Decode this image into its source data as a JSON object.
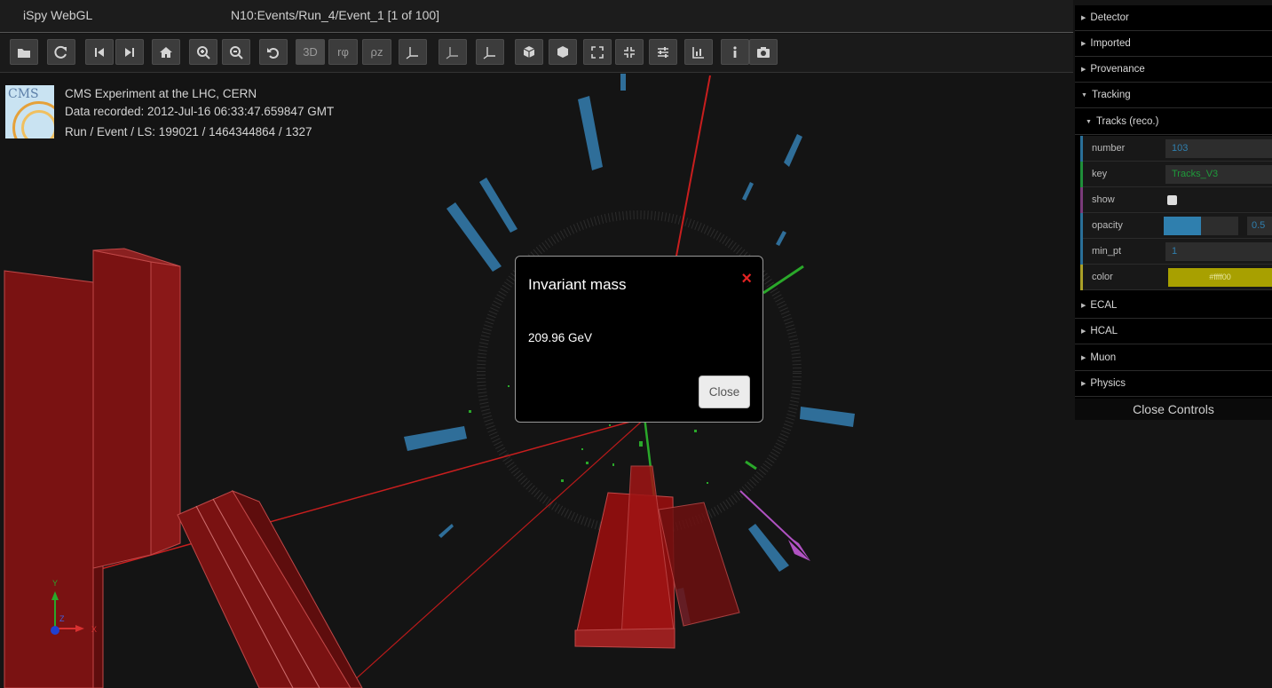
{
  "app": {
    "title": "iSpy WebGL",
    "event_title": "N10:Events/Run_4/Event_1 [1 of 100]"
  },
  "toolbar": {
    "buttons": [
      {
        "name": "open-file-button",
        "icon": "folder-icon"
      },
      {
        "name": "reload-button",
        "icon": "refresh-icon"
      },
      {
        "name": "prev-event-button",
        "icon": "skip-back-icon"
      },
      {
        "name": "next-event-button",
        "icon": "skip-forward-icon"
      },
      {
        "name": "home-view-button",
        "icon": "home-icon"
      },
      {
        "name": "zoom-in-button",
        "icon": "zoom-in-icon"
      },
      {
        "name": "zoom-out-button",
        "icon": "zoom-out-icon"
      },
      {
        "name": "reset-rotation-button",
        "icon": "undo-icon"
      },
      {
        "name": "view-3d-button",
        "label": "3D"
      },
      {
        "name": "view-rphi-button",
        "label": "rφ"
      },
      {
        "name": "view-rhoz-button",
        "label": "ρz"
      },
      {
        "name": "view-yz-x-button",
        "icon": "axis-yz-x-icon"
      },
      {
        "name": "view-yx-z-button",
        "icon": "axis-yx-z-icon"
      },
      {
        "name": "view-xy-z-button",
        "icon": "axis-xy-z-icon"
      },
      {
        "name": "perspective-button",
        "icon": "cube-icon"
      },
      {
        "name": "orthographic-button",
        "icon": "cube-solid-icon"
      },
      {
        "name": "fullscreen-button",
        "icon": "expand-icon"
      },
      {
        "name": "exit-fullscreen-button",
        "icon": "compress-icon"
      },
      {
        "name": "settings-button",
        "icon": "sliders-icon"
      },
      {
        "name": "table-button",
        "icon": "chart-icon"
      },
      {
        "name": "info-button",
        "icon": "info-icon"
      },
      {
        "name": "screenshot-button",
        "icon": "camera-icon"
      }
    ]
  },
  "overlay": {
    "line1": "CMS Experiment at the LHC, CERN",
    "line2": "Data recorded: 2012-Jul-16 06:33:47.659847 GMT",
    "line3": "Run / Event / LS: 199021 / 1464344864 / 1327",
    "logo_text": "CMS"
  },
  "axes": {
    "y": "Y",
    "x": "X",
    "z": "Z"
  },
  "modal": {
    "title": "Invariant mass",
    "close_x": "×",
    "body": "209.96 GeV",
    "close_label": "Close"
  },
  "controls": {
    "sections": [
      "Detector",
      "Imported",
      "Provenance",
      "Tracking"
    ],
    "subsection": "Tracks (reco.)",
    "props": [
      {
        "name": "number",
        "value": "103",
        "color": "#2a6f98"
      },
      {
        "name": "key",
        "value": "Tracks_V3",
        "color": "#1f8f3a"
      },
      {
        "name": "show",
        "value": "",
        "color": "#7a3b7a"
      },
      {
        "name": "opacity",
        "value": "0.5",
        "color": "#2a6f98"
      },
      {
        "name": "min_pt",
        "value": "1",
        "color": "#2a6f98"
      },
      {
        "name": "color",
        "value": "#ffff00",
        "color": "#aaa028"
      }
    ],
    "more_sections": [
      "ECAL",
      "HCAL",
      "Muon",
      "Physics"
    ],
    "close_label": "Close Controls"
  },
  "colors": {
    "accent_track": "#c81e1e",
    "muon_block": "#7a1212",
    "ecal_blue": "#2f6e99",
    "track_green": "#2aa82a",
    "met_arrow": "#b052c2"
  }
}
